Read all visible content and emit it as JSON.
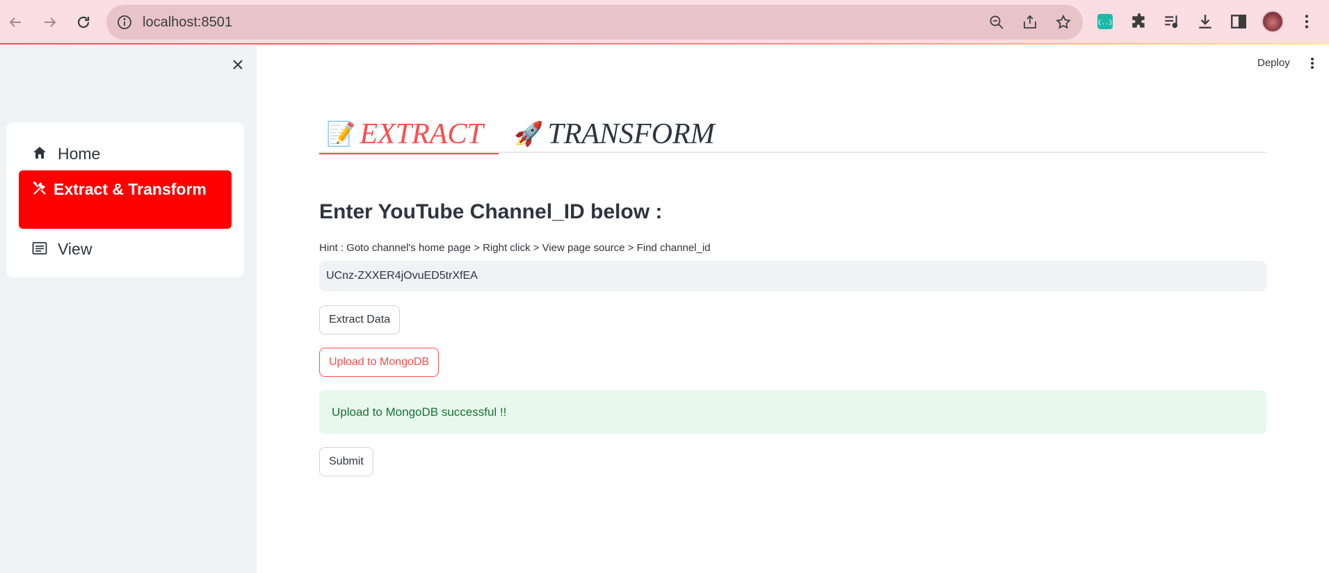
{
  "browser": {
    "url": "localhost:8501"
  },
  "sidebar": {
    "items": [
      {
        "label": "Home",
        "icon": "house-icon"
      },
      {
        "label": "Extract & Transform",
        "icon": "tools-icon",
        "active": true
      },
      {
        "label": "View",
        "icon": "list-icon"
      }
    ],
    "active_color": "#ff0000"
  },
  "header": {
    "deploy_label": "Deploy"
  },
  "main": {
    "tabs": [
      {
        "label": "EXTRACT",
        "emoji": "📝",
        "active": true
      },
      {
        "label": "TRANSFORM",
        "emoji": "🚀",
        "active": false
      }
    ],
    "heading": "Enter YouTube Channel_ID below :",
    "hint": "Hint : Goto channel's home page > Right click > View page source > Find channel_id",
    "channel_input_value": "UCnz-ZXXER4jOvuED5trXfEA",
    "extract_button": "Extract Data",
    "upload_button": "Upload to MongoDB",
    "success_message": "Upload to MongoDB successful !!",
    "submit_button": "Submit"
  },
  "colors": {
    "accent": "#ff4b4b",
    "success_bg": "#e8f8ed",
    "success_text": "#177233"
  }
}
